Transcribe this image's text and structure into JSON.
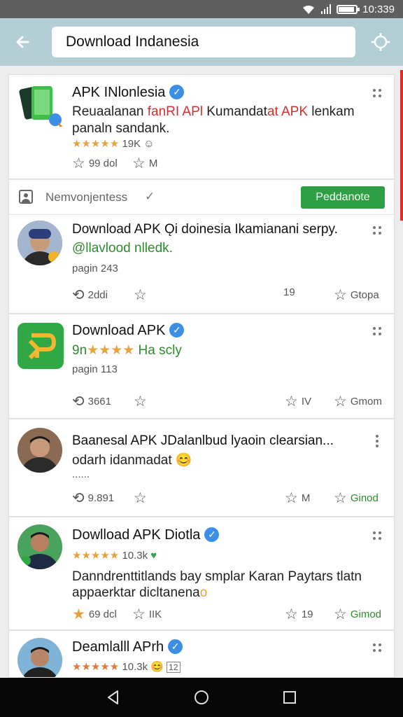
{
  "status_bar": {
    "time": "10:339"
  },
  "search": {
    "query": "Download Indanesia"
  },
  "cards": [
    {
      "title": "APK INlonlesia",
      "desc_line1_a": "Reuaalanan ",
      "desc_line1_b": "fanRI APl",
      "desc_line1_c": " Kumandat",
      "desc_line1_d": "at APK",
      "desc_line1_e": " lenkam",
      "desc_line2": "panaln sandank.",
      "stars": "★★★★★",
      "rating_count": "19K",
      "stat_a": "99 dol",
      "stat_b": "M"
    },
    {
      "section_label": "Nemvonjentess",
      "follow_button": "Peddanote",
      "title": "Download APK Ǫi doinesia  Ikamianani serpy.",
      "subtitle": "@llavlood nlledk.",
      "meta": "pagin 243",
      "stat_comments": "2ddi",
      "stat_shares": "19",
      "stat_save": "Gtopa"
    },
    {
      "title": "Download APK",
      "subtitle_prefix": "9n",
      "stars": "★★★★",
      "subtitle_text": " Ha scly",
      "meta": "pagin 113",
      "stat_comments": "3661",
      "stat_shares": "IV",
      "stat_save": "Gmom"
    },
    {
      "title": "Baanesal APK JDalanlbud  lyaoin clearsian...",
      "subtitle": "odarh idanmadat",
      "meta": "......",
      "stat_comments": "9.891",
      "stat_shares": "M",
      "stat_save": "Ginod"
    },
    {
      "title": "Dowlload APK Diotla",
      "stars": "★★★★★",
      "rating_count": "10.3k",
      "desc_line1": "Danndrenttitlands bay smplar Karan Paytars tlatn",
      "desc_line2_a": "appaerktar dicltanena",
      "desc_line2_b": "o",
      "stat_a": "69 dcl",
      "stat_b": "IIK",
      "stat_shares": "19",
      "stat_save": "Gimod"
    },
    {
      "title": "Deamlalll APrh",
      "stars": "★★★★★",
      "rating_count": "10.3k",
      "badge_count": "12"
    }
  ],
  "colors": {
    "app_bar": "#b3cfd5",
    "follow": "#2e9f44",
    "verified": "#3d8fe6",
    "accent_green": "#2e8b2e",
    "accent_red": "#d32f2f",
    "scroll_indicator": "#d9302b"
  },
  "icons": [
    "wifi-icon",
    "signal-icon",
    "battery-icon",
    "back-arrow-icon",
    "scan-icon",
    "more-vert-icon",
    "verified-icon",
    "star-icon",
    "comment-icon",
    "share-icon",
    "person-icon",
    "checkmark-icon",
    "nav-back-icon",
    "nav-home-icon",
    "nav-recents-icon"
  ],
  "battery_level": 0.85
}
